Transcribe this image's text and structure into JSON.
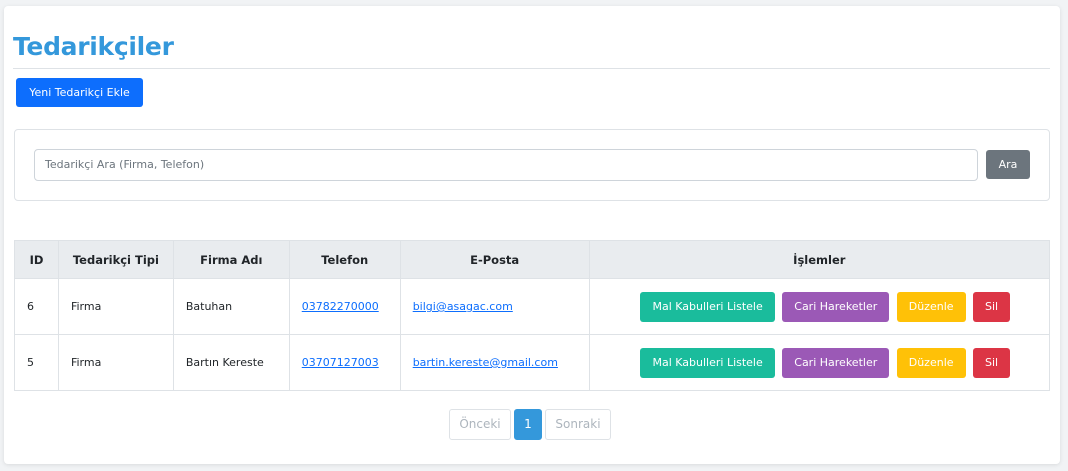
{
  "page": {
    "title": "Tedarikçiler"
  },
  "toolbar": {
    "new_label": "Yeni Tedarikçi Ekle"
  },
  "search": {
    "placeholder": "Tedarikçi Ara (Firma, Telefon)",
    "button_label": "Ara"
  },
  "table": {
    "headers": [
      "ID",
      "Tedarikçi Tipi",
      "Firma Adı",
      "Telefon",
      "E-Posta",
      "İşlemler"
    ],
    "rows": [
      {
        "id": "6",
        "type": "Firma",
        "company": "Batuhan",
        "phone": "03782270000",
        "email": "bilgi@asagac.com"
      },
      {
        "id": "5",
        "type": "Firma",
        "company": "Bartın Kereste",
        "phone": "03707127003",
        "email": "bartin.kereste@gmail.com"
      }
    ],
    "actions": {
      "receipts": "Mal Kabulleri Listele",
      "account": "Cari Hareketler",
      "edit": "Düzenle",
      "delete": "Sil"
    }
  },
  "pagination": {
    "prev": "Önceki",
    "current": "1",
    "next": "Sonraki"
  },
  "colors": {
    "accent": "#3498db",
    "primary": "#0d6efd",
    "green": "#1abc9c",
    "purple": "#9b59b6",
    "yellow": "#ffc107",
    "red": "#dc3545"
  }
}
